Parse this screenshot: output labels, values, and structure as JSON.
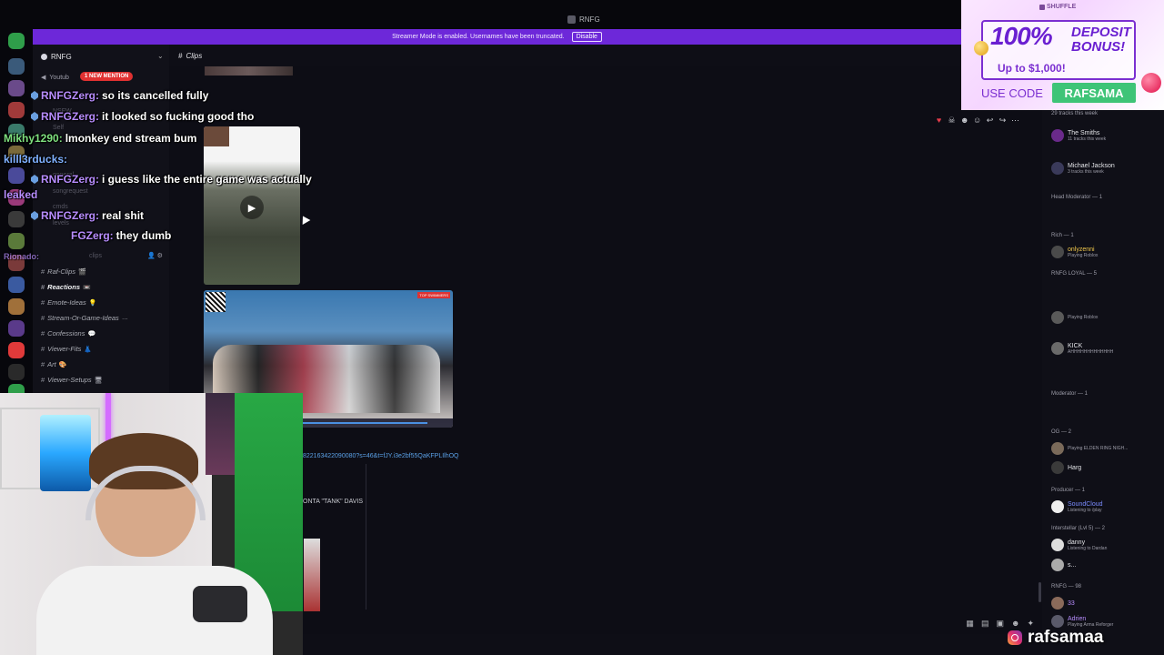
{
  "window": {
    "title": "RNFG"
  },
  "banner": {
    "text": "Streamer Mode is enabled. Usernames have been truncated.",
    "disable_label": "Disable"
  },
  "sidebar": {
    "server_name": "RNFG",
    "youtube_label": "Youtub",
    "mention_badge": "1 NEW MENTION",
    "faded_items": [
      "NSFW",
      "Self",
      "general",
      "songrequest",
      "cmds",
      "levels",
      "clips"
    ],
    "channels": [
      {
        "name": "Raf-Clips",
        "emoji": "🎬",
        "active": false
      },
      {
        "name": "Reactions",
        "emoji": "📼",
        "active": true
      },
      {
        "name": "Emote-Ideas",
        "emoji": "💡",
        "active": false
      },
      {
        "name": "Stream-Or-Game-Ideas",
        "emoji": "…",
        "active": false
      },
      {
        "name": "Confessions",
        "emoji": "💬",
        "active": false
      },
      {
        "name": "Viewer-Fits",
        "emoji": "👗",
        "active": false
      },
      {
        "name": "Art",
        "emoji": "🎨",
        "active": false
      },
      {
        "name": "Viewer-Setups",
        "emoji": "🖥",
        "active": false
      }
    ]
  },
  "channel": {
    "name": "Clips"
  },
  "messages": {
    "link": "822163422090080?s=46&t=fJY.i3e2bf55QaKFPLIlhOQ",
    "quote": "ONTA \"TANK\" DAVIS",
    "embed_badge": "TOP SWIMMERS",
    "embed_progress": 0.83
  },
  "chat": [
    {
      "user": "RNFGZerg:",
      "text": "so its cancelled fully",
      "badge": "mod"
    },
    {
      "user": "RNFGZerg:",
      "text": "it looked so fucking good tho",
      "badge": "mod"
    },
    {
      "user": "Mikhy1290:",
      "text": "lmonkey end stream bum",
      "badge": "none"
    },
    {
      "user": "killl3rducks:",
      "text": "",
      "badge": "none"
    },
    {
      "user": "RNFGZerg:",
      "text": "i guess like the entire game was actually",
      "badge": "mod"
    },
    {
      "user": "leaked",
      "text": "",
      "badge": "none"
    },
    {
      "user": "RNFGZerg:",
      "text": "real shit",
      "badge": "mod"
    },
    {
      "user": "FGZerg:",
      "text": "they dumb",
      "badge": "mod"
    },
    {
      "user": "Rionado:",
      "text": "",
      "badge": "none"
    }
  ],
  "members": {
    "top_notes": [
      "29 tracks this week"
    ],
    "artists": [
      {
        "name": "The Smiths",
        "sub": "11 tracks this week"
      },
      {
        "name": "Michael Jackson",
        "sub": "3 tracks this week"
      }
    ],
    "categories": [
      {
        "label": "Head Moderator — 1"
      },
      {
        "label": "Rich — 1"
      },
      {
        "label": "RNFG LOYAL — 5"
      },
      {
        "label": "Moderator — 1"
      },
      {
        "label": "OG — 2"
      },
      {
        "label": "Producer — 1"
      },
      {
        "label": "Interstellar (Lvl 5) — 2"
      },
      {
        "label": "RNFG — 98"
      }
    ],
    "users": [
      {
        "name": "onlyzenni",
        "sub": "Playing Roblox",
        "color": "#f2c94c"
      },
      {
        "name": "Playing Roblox",
        "sub": "",
        "color": "#9c9ca8"
      },
      {
        "name": "KICK",
        "sub": "AHHHHHHHHHHHHH",
        "color": "#e3e4e8"
      },
      {
        "name": "Playing ELDEN RING NIGH...",
        "sub": "",
        "color": "#9c9ca8"
      },
      {
        "name": "Harg",
        "sub": "",
        "color": "#e3e4e8"
      },
      {
        "name": "SoundCloud",
        "sub": "Listening to /play",
        "color": "#7b8cff"
      },
      {
        "name": "danny",
        "sub": "Listening to Dardan",
        "color": "#e3e4e8"
      },
      {
        "name": "s...",
        "sub": "",
        "color": "#e3e4e8"
      },
      {
        "name": "33",
        "sub": "",
        "color": "#b88dff"
      },
      {
        "name": "Adrien",
        "sub": "Playing Arma Reforger",
        "color": "#b88dff"
      }
    ]
  },
  "ad": {
    "brand": "SHUFFLE",
    "headline": "100%",
    "line1": "DEPOSIT",
    "line2": "BONUS!",
    "upto": "Up to $1,000!",
    "use_code": "USE CODE",
    "code": "RAFSAMA"
  },
  "watermark": {
    "handle": "rafsamaa"
  },
  "colors": {
    "accent": "#6d28d9",
    "mention": "#e03131",
    "code_bg": "#3ec477"
  }
}
